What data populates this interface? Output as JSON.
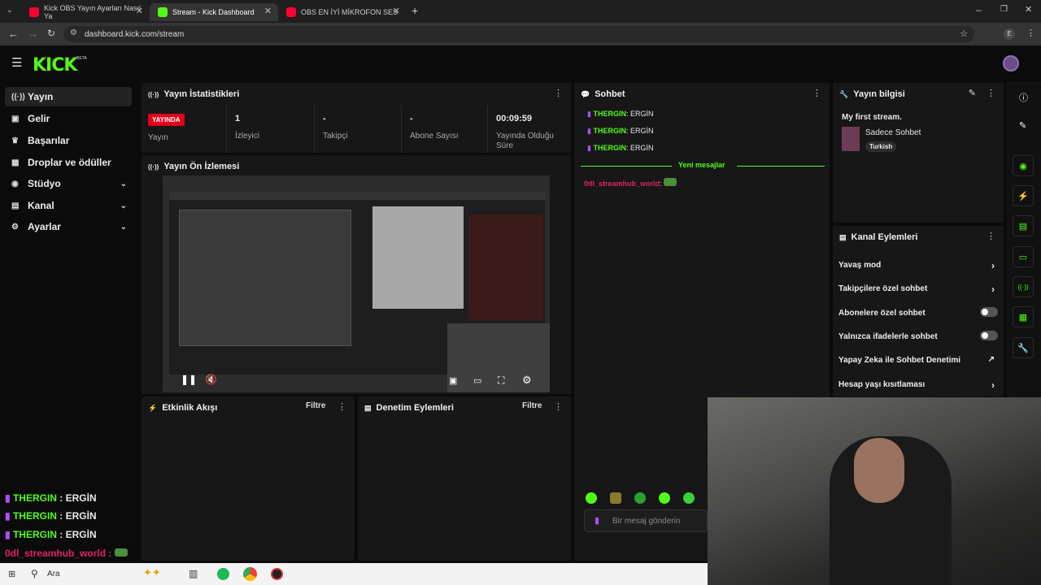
{
  "browser": {
    "tabs": [
      {
        "title": "Kick OBS Yayın Ayarları Nasıl Ya",
        "favicon_color": "#ff0033"
      },
      {
        "title": "Stream - Kick Dashboard",
        "favicon_color": "#53fc18"
      },
      {
        "title": "OBS EN İYİ MİKROFON SES",
        "favicon_color": "#ff0033"
      }
    ],
    "url": "dashboard.kick.com/stream",
    "profile_initial": "E"
  },
  "brand": {
    "logo": "KICK",
    "badge": "BETA",
    "accent": "#53fc18"
  },
  "sidebar": {
    "items": [
      {
        "label": "Yayın",
        "icon": "broadcast-icon"
      },
      {
        "label": "Gelir",
        "icon": "wallet-icon"
      },
      {
        "label": "Başarılar",
        "icon": "trophy-icon"
      },
      {
        "label": "Droplar ve ödüller",
        "icon": "gift-icon"
      },
      {
        "label": "Stüdyo",
        "icon": "studio-icon"
      },
      {
        "label": "Kanal",
        "icon": "channel-icon"
      },
      {
        "label": "Ayarlar",
        "icon": "gear-icon"
      }
    ]
  },
  "stats": {
    "title": "Yayın İstatistikleri",
    "status_badge": "YAYINDA",
    "status_label": "Yayın",
    "items": [
      {
        "value": "1",
        "label": "İzleyici"
      },
      {
        "value": "-",
        "label": "Takipçi"
      },
      {
        "value": "-",
        "label": "Abone Sayısı"
      },
      {
        "value": "00:09:59",
        "label": "Yayında Olduğu Süre"
      }
    ]
  },
  "preview": {
    "title": "Yayın Ön İzlemesi"
  },
  "activity": {
    "title": "Etkinlik Akışı",
    "filter": "Filtre"
  },
  "moderation": {
    "title": "Denetim Eylemleri",
    "filter": "Filtre"
  },
  "chat": {
    "title": "Sohbet",
    "messages": [
      {
        "user": "THERGIN",
        "text": "ERGİN",
        "color": "#53fc18"
      },
      {
        "user": "THERGIN",
        "text": "ERGİN",
        "color": "#53fc18"
      },
      {
        "user": "THERGIN",
        "text": "ERGİN",
        "color": "#53fc18"
      }
    ],
    "new_messages": "Yeni mesajlar",
    "new_message": {
      "user": "0dl_streamhub_world",
      "color": "#e0245e"
    },
    "placeholder": "Bir mesaj gönderin"
  },
  "stream_info": {
    "title": "Yayın bilgisi",
    "stream_title": "My first stream.",
    "category": "Sadece Sohbet",
    "tag": "Turkish"
  },
  "channel_actions": {
    "title": "Kanal Eylemleri",
    "items": [
      {
        "label": "Yavaş mod",
        "control": "chevron"
      },
      {
        "label": "Takipçilere özel sohbet",
        "control": "chevron"
      },
      {
        "label": "Abonelere özel sohbet",
        "control": "toggle"
      },
      {
        "label": "Yalnızca ifadelerle sohbet",
        "control": "toggle"
      },
      {
        "label": "Yapay Zeka ile Sohbet Denetimi",
        "control": "external"
      },
      {
        "label": "Hesap yaşı kısıtlaması",
        "control": "chevron"
      }
    ]
  },
  "overlay_chat": {
    "messages": [
      {
        "user": "THERGIN",
        "text": "ERGİN"
      },
      {
        "user": "THERGIN",
        "text": "ERGİN"
      },
      {
        "user": "THERGIN",
        "text": "ERGİN"
      }
    ],
    "last_user": "0dl_streamhub_world :"
  },
  "taskbar": {
    "search_label": "Ara"
  }
}
